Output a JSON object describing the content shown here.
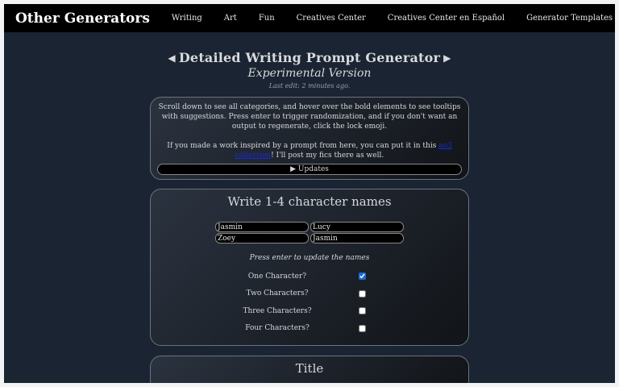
{
  "nav": {
    "brand": "Other Generators",
    "links": [
      "Writing",
      "Art",
      "Fun",
      "Creatives Center",
      "Creatives Center en Español",
      "Generator Templates"
    ]
  },
  "header": {
    "title": "Detailed Writing Prompt Generator",
    "prev_arrow": "◀",
    "next_arrow": "▶",
    "subtitle": "Experimental Version",
    "last_edit": "Last edit: 2 minutes ago."
  },
  "info": {
    "paragraph1": "Scroll down to see all categories, and hover over the bold elements to see tooltips with suggestions. Press enter to trigger randomization, and if you don't want an output to regenerate, click the lock emoji.",
    "paragraph2_before": "If you made a work inspired by a prompt from here, you can put it in this ",
    "paragraph2_link": "ao3 collection",
    "paragraph2_after": "! I'll post my fics there as well.",
    "updates_label": "▶ Updates"
  },
  "names": {
    "heading": "Write 1-4 character names",
    "inputs": [
      "Jasmin",
      "Lucy",
      "Zoey",
      "Jasmin"
    ],
    "hint": "Press enter to update the names",
    "options": [
      {
        "label": "One Character?",
        "checked": true
      },
      {
        "label": "Two Characters?",
        "checked": false
      },
      {
        "label": "Three Characters?",
        "checked": false
      },
      {
        "label": "Four Characters?",
        "checked": false
      }
    ]
  },
  "title_section": {
    "heading": "Title"
  }
}
